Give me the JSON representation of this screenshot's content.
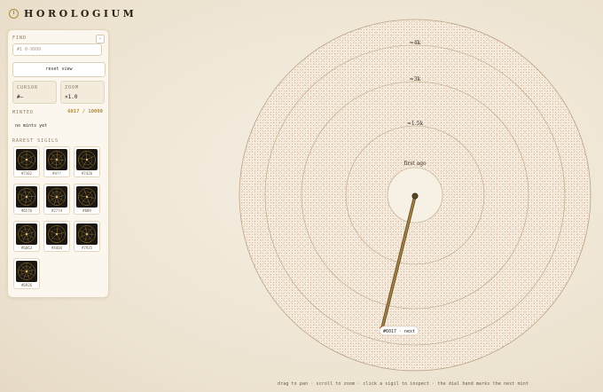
{
  "brand": {
    "title": "HOROLOGIUM"
  },
  "panel": {
    "find_label": "FIND",
    "collapse_label": "‹",
    "search_placeholder": "#1 0-9999",
    "reset_label": "reset view",
    "cursor_label": "CURSOR",
    "cursor_value": "#—",
    "zoom_label": "ZOOM",
    "zoom_value": "×1.0",
    "minted_label": "MINTED",
    "minted_value": "6017 / 10000",
    "mints_yet": "no mints yet",
    "rarest_label": "RAREST SIGILS",
    "sigils": [
      "#7162",
      "#4??",
      "#7426",
      "#6576",
      "#2774",
      "#889",
      "#6863",
      "#4404",
      "#7935",
      "#6926"
    ]
  },
  "dial": {
    "rings": [
      "≈4k",
      "≈3k",
      "≈1.5k",
      "first ago"
    ],
    "next_label": "#6017 · next",
    "hand_colors": {
      "hand": "#8a6a32",
      "tip": "#c0392b"
    }
  },
  "hint": "drag to pan · scroll to zoom · click a sigil to inspect · the dial hand marks the next mint"
}
